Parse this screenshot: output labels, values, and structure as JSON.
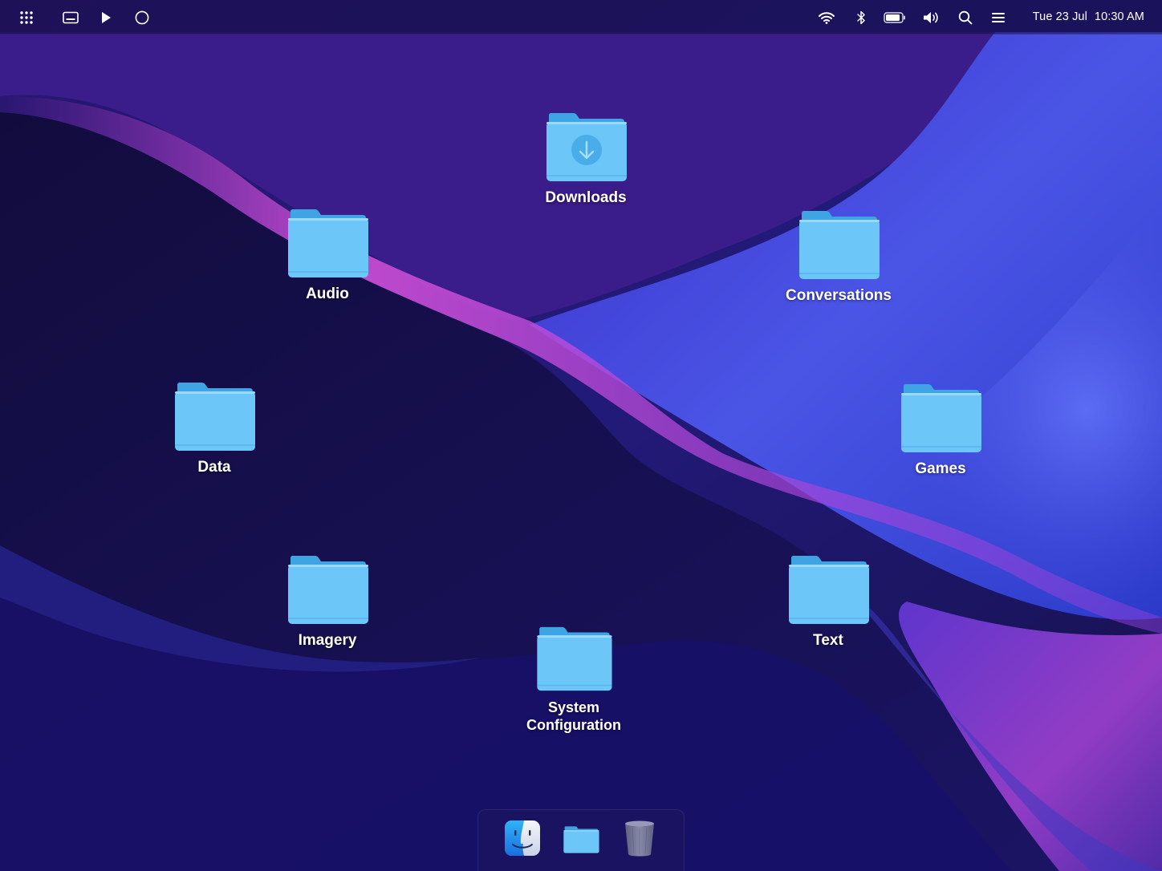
{
  "menubar": {
    "left_icons": [
      "apps-grid-icon",
      "keyboard-icon",
      "play-icon",
      "circle-icon"
    ],
    "right_icons": [
      "wifi-icon",
      "bluetooth-icon",
      "battery-icon",
      "volume-icon",
      "search-icon",
      "menu-icon"
    ],
    "date": "Tue 23 Jul",
    "time": "10:30 AM"
  },
  "desktop": {
    "folders": [
      {
        "label": "Downloads",
        "icon": "downloads-folder-icon"
      },
      {
        "label": "Audio",
        "icon": "folder-icon"
      },
      {
        "label": "Conversations",
        "icon": "folder-icon"
      },
      {
        "label": "Data",
        "icon": "folder-icon"
      },
      {
        "label": "Games",
        "icon": "folder-icon"
      },
      {
        "label": "Imagery",
        "icon": "folder-icon"
      },
      {
        "label": "Text",
        "icon": "folder-icon"
      },
      {
        "label": "System\nConfiguration",
        "icon": "folder-icon"
      }
    ]
  },
  "dock": {
    "items": [
      "finder-icon",
      "folder-icon",
      "trash-icon"
    ]
  },
  "colors": {
    "folder_body": "#6cc6f7",
    "folder_back": "#3ea4e3",
    "background_dark": "#15104a",
    "background_pink": "#d94bd6",
    "background_blue": "#4a4fe0"
  }
}
